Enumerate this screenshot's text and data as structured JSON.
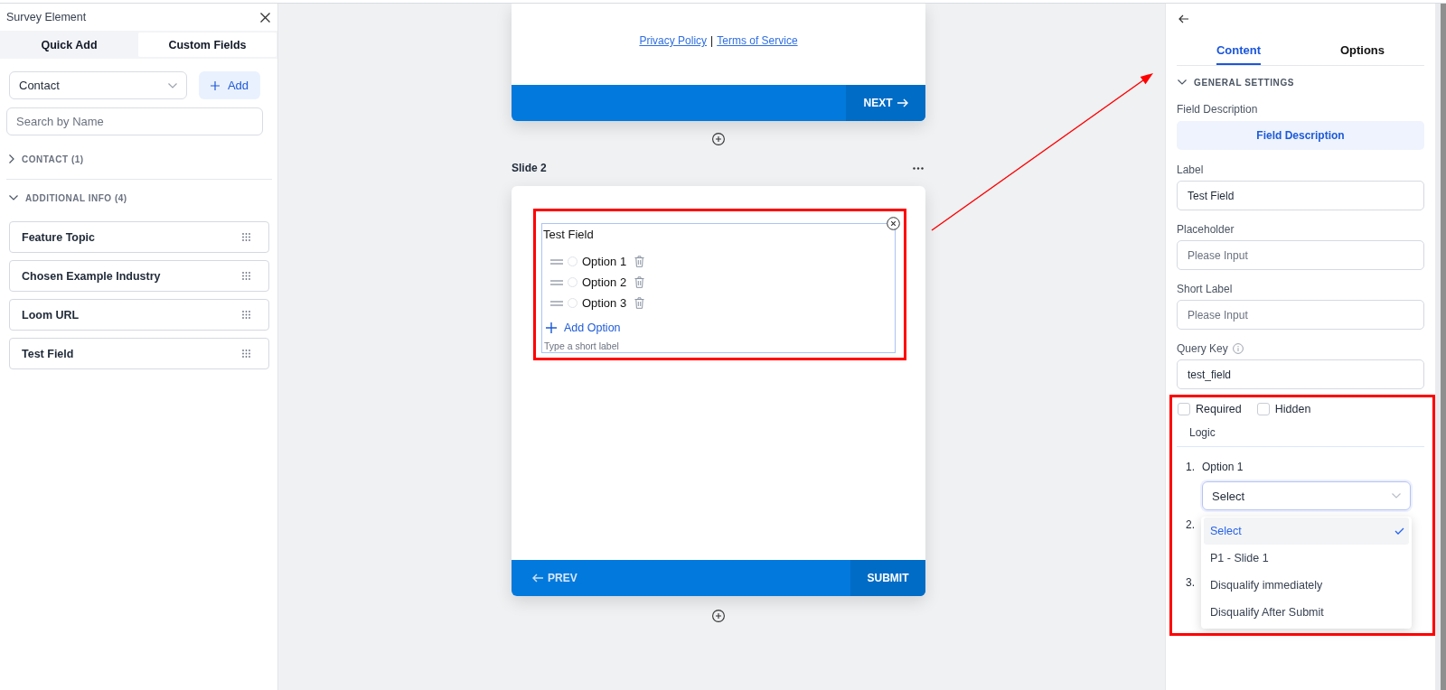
{
  "left_panel": {
    "title": "Survey Element",
    "tabs": [
      {
        "label": "Quick Add",
        "selected": false
      },
      {
        "label": "Custom Fields",
        "selected": true
      }
    ],
    "object_select": {
      "value": "Contact"
    },
    "add_button": {
      "label": "Add"
    },
    "search": {
      "placeholder": "Search by Name"
    },
    "groups": [
      {
        "label": "CONTACT (1)",
        "expanded": false
      },
      {
        "label": "ADDITIONAL INFO (4)",
        "expanded": true,
        "items": [
          {
            "label": "Feature Topic"
          },
          {
            "label": "Chosen Example Industry"
          },
          {
            "label": "Loom URL"
          },
          {
            "label": "Test Field"
          }
        ]
      }
    ]
  },
  "canvas": {
    "previous_slide": {
      "links": [
        {
          "text": "Privacy Policy"
        },
        {
          "text": "Terms of Service"
        }
      ],
      "separator": "|",
      "buttons": [
        {
          "label": "NEXT",
          "kind": "next"
        }
      ]
    },
    "slide": {
      "title": "Slide 2",
      "field": {
        "label": "Test Field",
        "options": [
          {
            "label": "Option 1",
            "selected": false
          },
          {
            "label": "Option 2",
            "selected": false
          },
          {
            "label": "Option 3",
            "selected": false
          }
        ],
        "add_option": "Add Option",
        "short_label": {
          "placeholder": "Type a short label"
        }
      },
      "buttons": [
        {
          "label": "PREV",
          "kind": "prev"
        },
        {
          "label": "SUBMIT",
          "kind": "submit"
        }
      ]
    }
  },
  "settings_panel": {
    "tabs": [
      {
        "label": "Content",
        "selected": true
      },
      {
        "label": "Options",
        "selected": false
      }
    ],
    "section": {
      "title": "GENERAL SETTINGS",
      "expanded": true
    },
    "field_description": {
      "label": "Field Description",
      "button": "Field Description"
    },
    "fields": [
      {
        "label": "Label",
        "value": "Test Field",
        "info": false
      },
      {
        "label": "Placeholder",
        "placeholder": "Please Input",
        "info": false
      },
      {
        "label": "Short Label",
        "placeholder": "Please Input",
        "info": false
      },
      {
        "label": "Query Key",
        "value": "test_field",
        "info": true
      }
    ],
    "checkboxes": [
      {
        "label": "Required",
        "checked": false
      },
      {
        "label": "Hidden",
        "checked": false
      }
    ],
    "logic": {
      "title": "Logic",
      "rules": [
        {
          "number": "1.",
          "option": "Option 1",
          "select": {
            "value": "Select",
            "open": true,
            "options": [
              {
                "label": "Select",
                "selected": true
              },
              {
                "label": "P1 - Slide 1",
                "selected": false
              },
              {
                "label": "Disqualify immediately",
                "selected": false
              },
              {
                "label": "Disqualify After Submit",
                "selected": false
              }
            ]
          }
        },
        {
          "number": "2."
        },
        {
          "number": "3."
        }
      ]
    }
  }
}
